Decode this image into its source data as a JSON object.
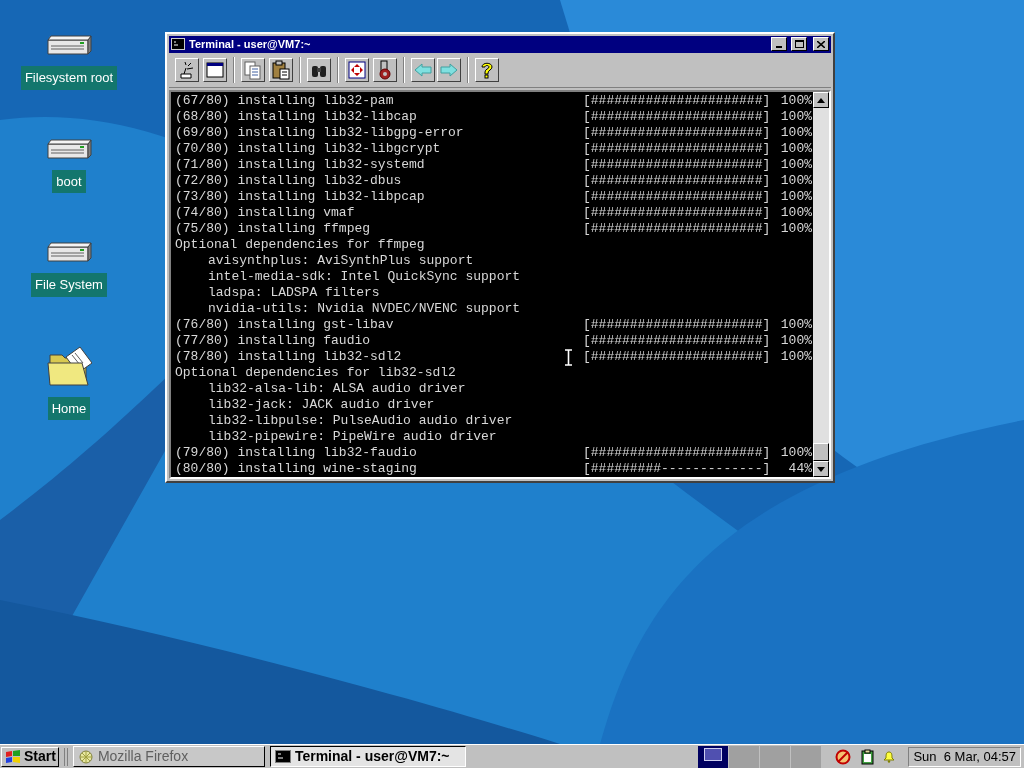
{
  "desktop_icons": [
    {
      "label": "Filesystem root",
      "kind": "drive"
    },
    {
      "label": "boot",
      "kind": "drive"
    },
    {
      "label": "File System",
      "kind": "drive"
    },
    {
      "label": "Home",
      "kind": "folder"
    }
  ],
  "window": {
    "title": "Terminal - user@VM7:~"
  },
  "terminal_lines": [
    {
      "kind": "progress",
      "text": "(67/80) installing lib32-pam",
      "bar": "[######################]",
      "percent": "100%"
    },
    {
      "kind": "progress",
      "text": "(68/80) installing lib32-libcap",
      "bar": "[######################]",
      "percent": "100%"
    },
    {
      "kind": "progress",
      "text": "(69/80) installing lib32-libgpg-error",
      "bar": "[######################]",
      "percent": "100%"
    },
    {
      "kind": "progress",
      "text": "(70/80) installing lib32-libgcrypt",
      "bar": "[######################]",
      "percent": "100%"
    },
    {
      "kind": "progress",
      "text": "(71/80) installing lib32-systemd",
      "bar": "[######################]",
      "percent": "100%"
    },
    {
      "kind": "progress",
      "text": "(72/80) installing lib32-dbus",
      "bar": "[######################]",
      "percent": "100%"
    },
    {
      "kind": "progress",
      "text": "(73/80) installing lib32-libpcap",
      "bar": "[######################]",
      "percent": "100%"
    },
    {
      "kind": "progress",
      "text": "(74/80) installing vmaf",
      "bar": "[######################]",
      "percent": "100%"
    },
    {
      "kind": "progress",
      "text": "(75/80) installing ffmpeg",
      "bar": "[######################]",
      "percent": "100%"
    },
    {
      "kind": "heading",
      "text": "Optional dependencies for ffmpeg"
    },
    {
      "kind": "dependency",
      "text": "avisynthplus: AviSynthPlus support"
    },
    {
      "kind": "dependency",
      "text": "intel-media-sdk: Intel QuickSync support"
    },
    {
      "kind": "dependency",
      "text": "ladspa: LADSPA filters"
    },
    {
      "kind": "dependency",
      "text": "nvidia-utils: Nvidia NVDEC/NVENC support"
    },
    {
      "kind": "progress",
      "text": "(76/80) installing gst-libav",
      "bar": "[######################]",
      "percent": "100%"
    },
    {
      "kind": "progress",
      "text": "(77/80) installing faudio",
      "bar": "[######################]",
      "percent": "100%"
    },
    {
      "kind": "progress",
      "text": "(78/80) installing lib32-sdl2",
      "bar": "[######################]",
      "percent": "100%"
    },
    {
      "kind": "heading",
      "text": "Optional dependencies for lib32-sdl2"
    },
    {
      "kind": "dependency",
      "text": "lib32-alsa-lib: ALSA audio driver"
    },
    {
      "kind": "dependency",
      "text": "lib32-jack: JACK audio driver"
    },
    {
      "kind": "dependency",
      "text": "lib32-libpulse: PulseAudio audio driver"
    },
    {
      "kind": "dependency",
      "text": "lib32-pipewire: PipeWire audio driver"
    },
    {
      "kind": "progress",
      "text": "(79/80) installing lib32-faudio",
      "bar": "[######################]",
      "percent": "100%"
    },
    {
      "kind": "progress",
      "text": "(80/80) installing wine-staging",
      "bar": "[#########-------------]",
      "percent": "44%"
    }
  ],
  "taskbar": {
    "start": "Start",
    "tasks": [
      {
        "label": "Mozilla Firefox",
        "kind": "browser",
        "selected": false
      },
      {
        "label": "Terminal - user@VM7:~",
        "kind": "terminal",
        "selected": true
      }
    ],
    "desktops": [
      {
        "selected": true
      },
      {
        "selected": false
      },
      {
        "selected": false
      },
      {
        "selected": false
      }
    ],
    "clock": "Sun  6 Mar, 04:57"
  }
}
